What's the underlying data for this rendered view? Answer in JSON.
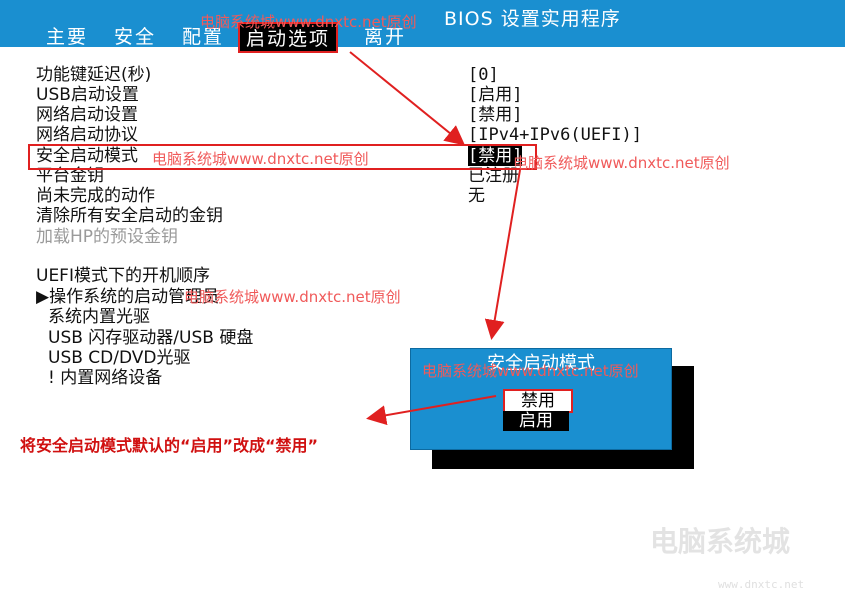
{
  "header": {
    "title": "BIOS 设置实用程序",
    "tabs": [
      {
        "label": "主要"
      },
      {
        "label": "安全"
      },
      {
        "label": "配置"
      },
      {
        "label": "启动选项"
      },
      {
        "label": "离开"
      }
    ]
  },
  "settings": [
    {
      "label": "功能键延迟(秒)",
      "value": "[0]"
    },
    {
      "label": "USB启动设置",
      "value": "[启用]"
    },
    {
      "label": "网络启动设置",
      "value": "[禁用]"
    },
    {
      "label": "网络启动协议",
      "value": "[IPv4+IPv6(UEFI)]"
    },
    {
      "label": "安全启动模式",
      "value": "[禁用]"
    },
    {
      "label": "平台金钥",
      "value": "已注册"
    },
    {
      "label": "尚未完成的动作",
      "value": "无"
    },
    {
      "label": "清除所有安全启动的金钥",
      "value": ""
    },
    {
      "label": "加载HP的预设金钥",
      "value": ""
    }
  ],
  "boot_order": {
    "heading": "UEFI模式下的开机顺序",
    "items": [
      "▶操作系统的启动管理员",
      "系统内置光驱",
      "USB 闪存驱动器/USB 硬盘",
      "USB CD/DVD光驱",
      "! 内置网络设备"
    ]
  },
  "popup": {
    "title": "安全启动模式",
    "options": [
      "禁用",
      "启用"
    ],
    "selected": "禁用"
  },
  "annotation": "将安全启动模式默认的“启用”改成“禁用”",
  "watermarks": [
    "电脑系统城www.dnxtc.net原创",
    "电脑系统城www.dnxtc.net原创",
    "电脑系统城www.dnxtc.net原创",
    "电脑系统城www.dnxtc.net原创",
    "电脑系统城www.dnxtc.net原创"
  ],
  "logo": {
    "name": "电脑系统城",
    "url": "www.dnxtc.net"
  },
  "colors": {
    "bios_blue": "#1a8fd0",
    "highlight_red": "#e02020"
  }
}
